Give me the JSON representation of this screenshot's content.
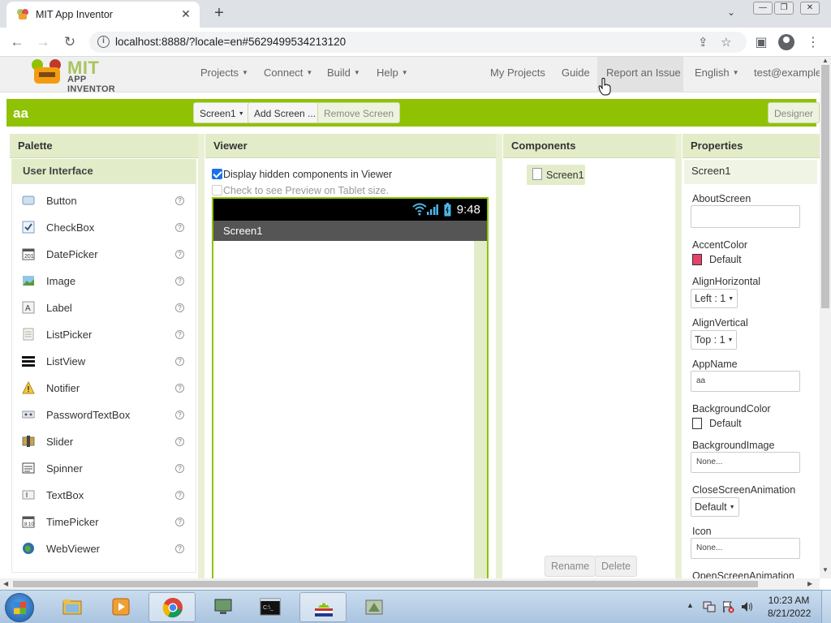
{
  "browser": {
    "tab_title": "MIT App Inventor",
    "url": "localhost:8888/?locale=en#5629499534213120"
  },
  "app": {
    "logo_mit": "MIT",
    "logo_subtitle": "APP INVENTOR",
    "menus": [
      "Projects",
      "Connect",
      "Build",
      "Help"
    ],
    "links": {
      "my_projects": "My Projects",
      "guide": "Guide",
      "report": "Report an Issue",
      "language": "English",
      "account": "test@example"
    }
  },
  "toolbar": {
    "project_name": "aa",
    "screen_select": "Screen1",
    "add_screen": "Add Screen ...",
    "remove_screen": "Remove Screen",
    "designer": "Designer"
  },
  "palette": {
    "title": "Palette",
    "category": "User Interface",
    "help_symbol": "?",
    "items": [
      {
        "label": "Button",
        "icon": "button-icon"
      },
      {
        "label": "CheckBox",
        "icon": "checkbox-icon"
      },
      {
        "label": "DatePicker",
        "icon": "datepicker-icon"
      },
      {
        "label": "Image",
        "icon": "image-icon"
      },
      {
        "label": "Label",
        "icon": "label-icon"
      },
      {
        "label": "ListPicker",
        "icon": "listpicker-icon"
      },
      {
        "label": "ListView",
        "icon": "listview-icon"
      },
      {
        "label": "Notifier",
        "icon": "notifier-icon"
      },
      {
        "label": "PasswordTextBox",
        "icon": "password-icon"
      },
      {
        "label": "Slider",
        "icon": "slider-icon"
      },
      {
        "label": "Spinner",
        "icon": "spinner-icon"
      },
      {
        "label": "TextBox",
        "icon": "textbox-icon"
      },
      {
        "label": "TimePicker",
        "icon": "timepicker-icon"
      },
      {
        "label": "WebViewer",
        "icon": "webviewer-icon"
      }
    ]
  },
  "viewer": {
    "title": "Viewer",
    "display_hidden": "Display hidden components in Viewer",
    "tablet_preview": "Check to see Preview on Tablet size.",
    "phone_time": "9:48",
    "screen_title": "Screen1"
  },
  "components": {
    "title": "Components",
    "root": "Screen1",
    "rename": "Rename",
    "delete": "Delete"
  },
  "properties": {
    "title": "Properties",
    "screen": "Screen1",
    "about_label": "AboutScreen",
    "accent_label": "AccentColor",
    "accent_value": "Default",
    "accent_color": "#e8426a",
    "align_h_label": "AlignHorizontal",
    "align_h_value": "Left : 1",
    "align_v_label": "AlignVertical",
    "align_v_value": "Top : 1",
    "appname_label": "AppName",
    "appname_value": "aa",
    "bgcolor_label": "BackgroundColor",
    "bgcolor_value": "Default",
    "bgimage_label": "BackgroundImage",
    "bgimage_value": "None...",
    "close_anim_label": "CloseScreenAnimation",
    "close_anim_value": "Default",
    "icon_label": "Icon",
    "icon_value": "None...",
    "open_anim_label": "OpenScreenAnimation"
  },
  "taskbar": {
    "time": "10:23 AM",
    "date": "8/21/2022"
  },
  "colors": {
    "brand_green": "#8fc202",
    "panel_header": "#e3ecc9"
  }
}
